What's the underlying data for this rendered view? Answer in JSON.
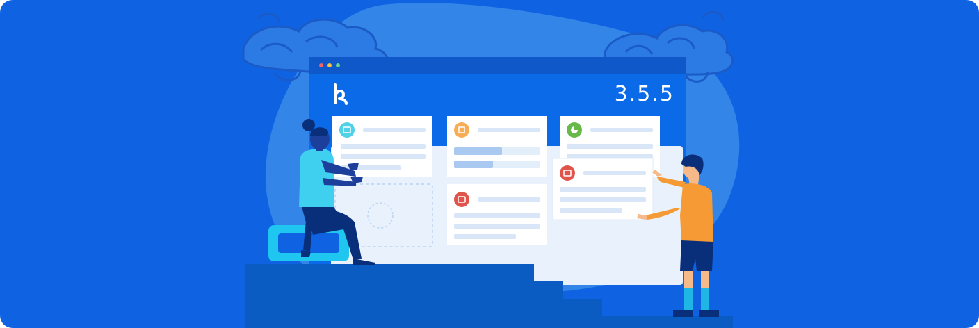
{
  "banner": {
    "version_label": "3.5.5",
    "logo_icon": "kanboard-k-logo-icon",
    "cards": [
      {
        "icon": "ticket-icon",
        "icon_color": "#4fd1e8"
      },
      {
        "icon": "cpu-chip-icon",
        "icon_color": "#f6ad55"
      },
      {
        "icon": "pie-chart-icon",
        "icon_color": "#68b84a"
      },
      {
        "icon": "archive-icon",
        "icon_color": "#e0554b"
      },
      {
        "icon": "inbox-icon",
        "icon_color": "#e0554b"
      }
    ],
    "progress_bars": [
      0.56,
      0.45
    ]
  },
  "colors": {
    "background": "#0f63e3",
    "blob": "#3a8be9",
    "window": "#0a6ae8",
    "titlebar": "#0f58c9",
    "stairs": "#0a5cc3",
    "card": "#ffffff",
    "line": "#d8e6f8",
    "progress": "#a9c9f1"
  }
}
